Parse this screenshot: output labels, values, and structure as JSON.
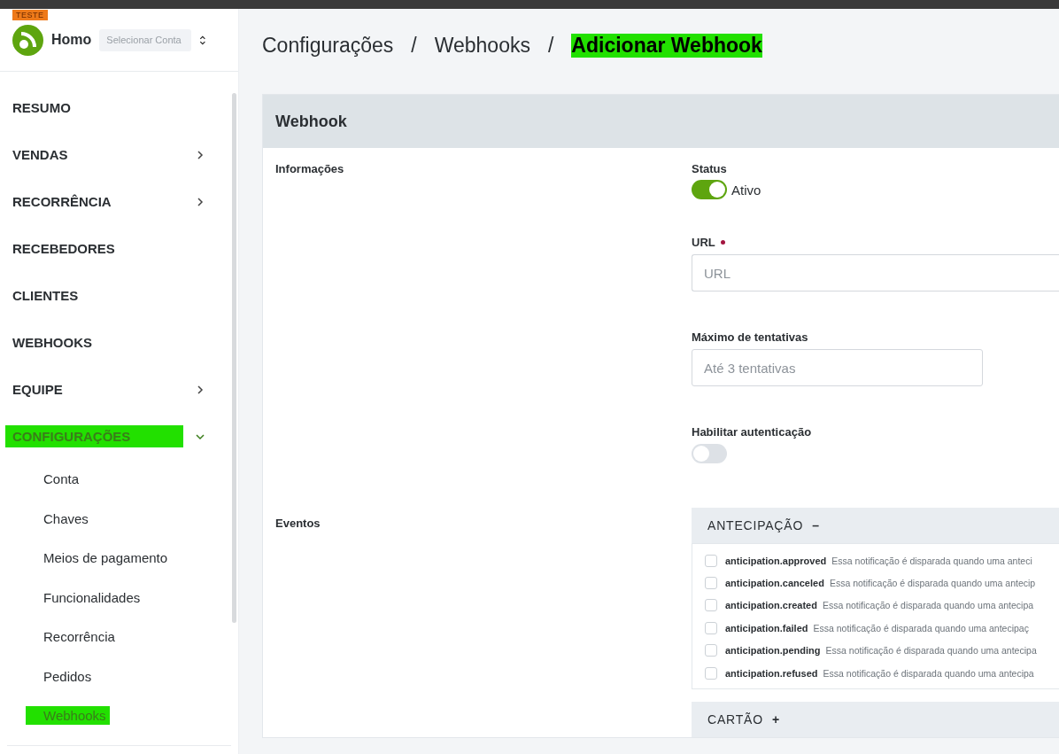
{
  "sidebar": {
    "badge": "TESTE",
    "account_name": "Homo",
    "account_select": {
      "placeholder": "Selecionar Conta"
    },
    "items": [
      {
        "label": "RESUMO",
        "kind": "plain",
        "highlighted": false
      },
      {
        "label": "VENDAS",
        "kind": "expandable",
        "expanded": false,
        "highlighted": false
      },
      {
        "label": "RECORRÊNCIA",
        "kind": "expandable",
        "expanded": false,
        "highlighted": false
      },
      {
        "label": "RECEBEDORES",
        "kind": "plain",
        "highlighted": false
      },
      {
        "label": "CLIENTES",
        "kind": "plain",
        "highlighted": false
      },
      {
        "label": "WEBHOOKS",
        "kind": "plain",
        "highlighted": false
      },
      {
        "label": "EQUIPE",
        "kind": "expandable",
        "expanded": false,
        "highlighted": false
      },
      {
        "label": "CONFIGURAÇÕES",
        "kind": "expandable",
        "expanded": true,
        "highlighted": true,
        "children": [
          {
            "label": "Conta",
            "highlighted": false
          },
          {
            "label": "Chaves",
            "highlighted": false
          },
          {
            "label": "Meios de pagamento",
            "highlighted": false
          },
          {
            "label": "Funcionalidades",
            "highlighted": false
          },
          {
            "label": "Recorrência",
            "highlighted": false
          },
          {
            "label": "Pedidos",
            "highlighted": false
          },
          {
            "label": "Webhooks",
            "highlighted": true
          }
        ]
      }
    ]
  },
  "breadcrumb": [
    {
      "label": "Configurações",
      "highlighted": false
    },
    {
      "label": "Webhooks",
      "highlighted": false
    },
    {
      "label": "Adicionar Webhook",
      "highlighted": true
    }
  ],
  "breadcrumb_separator": "/",
  "card": {
    "title": "Webhook",
    "info": {
      "label": "Informações",
      "status": {
        "label": "Status",
        "on": true,
        "text": "Ativo"
      },
      "url": {
        "label": "URL",
        "required": true,
        "placeholder": "URL"
      },
      "max_attempts": {
        "label": "Máximo de tentativas",
        "placeholder": "Até 3 tentativas"
      },
      "auth": {
        "label": "Habilitar autenticação",
        "on": false
      }
    },
    "events": {
      "label": "Eventos",
      "groups": [
        {
          "title": "ANTECIPAÇÃO",
          "toggle": "–",
          "expanded": true,
          "events": [
            {
              "name": "anticipation.approved",
              "description": "Essa notificação é disparada quando uma anteci",
              "checked": false
            },
            {
              "name": "anticipation.canceled",
              "description": "Essa notificação é disparada quando uma antecip",
              "checked": false
            },
            {
              "name": "anticipation.created",
              "description": "Essa notificação é disparada quando uma antecipa",
              "checked": false
            },
            {
              "name": "anticipation.failed",
              "description": "Essa notificação é disparada quando uma antecipaç",
              "checked": false
            },
            {
              "name": "anticipation.pending",
              "description": "Essa notificação é disparada quando uma antecipa",
              "checked": false
            },
            {
              "name": "anticipation.refused",
              "description": "Essa notificação é disparada quando uma antecipa",
              "checked": false
            }
          ]
        },
        {
          "title": "CARTÃO",
          "toggle": "+",
          "expanded": false
        }
      ]
    }
  }
}
